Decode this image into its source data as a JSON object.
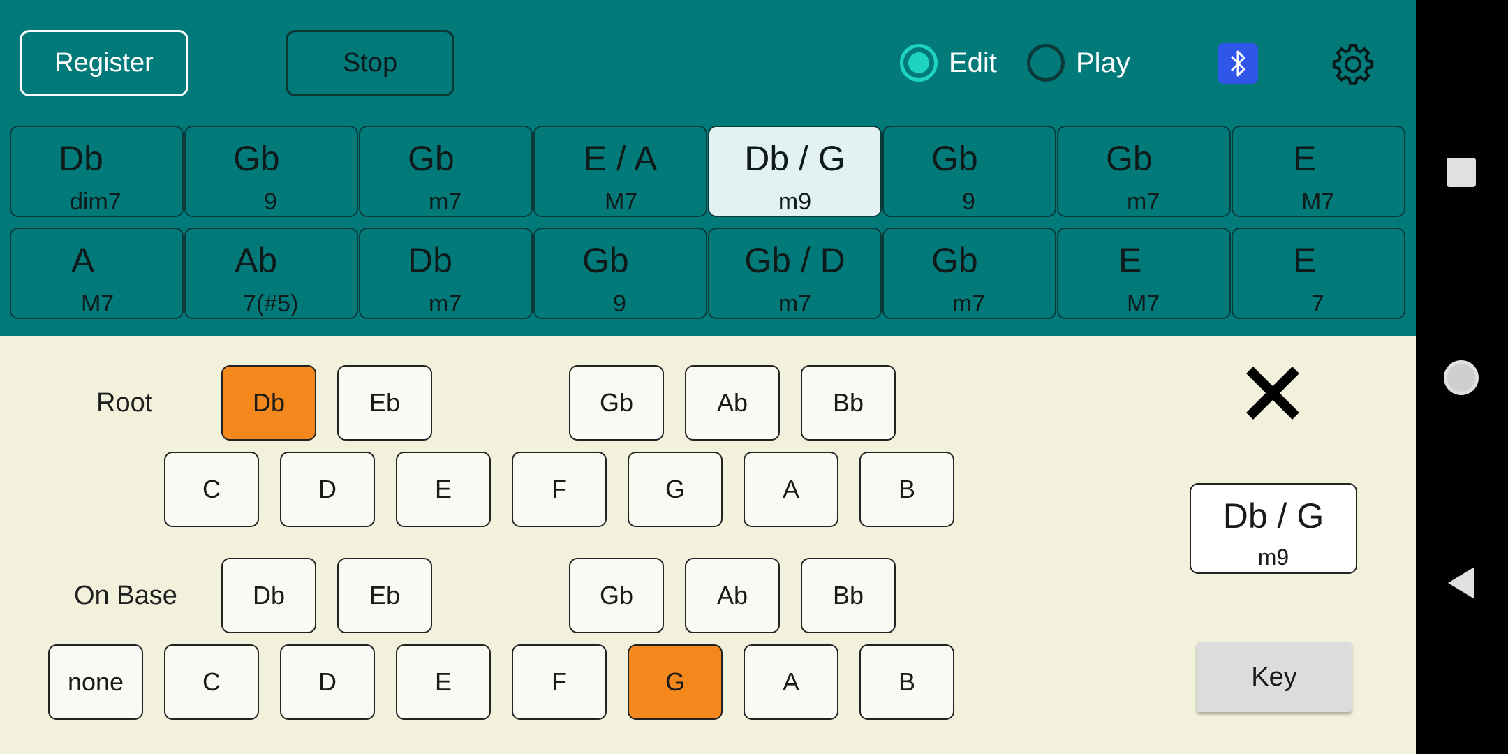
{
  "toolbar": {
    "register_label": "Register",
    "stop_label": "Stop",
    "mode_edit_label": "Edit",
    "mode_play_label": "Play",
    "selected_mode": "Edit",
    "bluetooth_icon": "bluetooth-icon",
    "settings_icon": "gear-icon",
    "bluetooth_color": "#2f55e9"
  },
  "progression": {
    "row1": [
      {
        "root": "Db",
        "quality": "dim7"
      },
      {
        "root": "Gb",
        "quality": "9"
      },
      {
        "root": "Gb",
        "quality": "m7"
      },
      {
        "root": "E / A",
        "quality": "M7"
      },
      {
        "root": "Db / G",
        "quality": "m9"
      },
      {
        "root": "Gb",
        "quality": "9"
      },
      {
        "root": "Gb",
        "quality": "m7"
      },
      {
        "root": "E",
        "quality": "M7"
      }
    ],
    "row2": [
      {
        "root": "A",
        "quality": "M7"
      },
      {
        "root": "Ab",
        "quality": "7(#5)"
      },
      {
        "root": "Db",
        "quality": "m7"
      },
      {
        "root": "Gb",
        "quality": "9"
      },
      {
        "root": "Gb / D",
        "quality": "m7"
      },
      {
        "root": "Gb",
        "quality": "m7"
      },
      {
        "root": "E",
        "quality": "M7"
      },
      {
        "root": "E",
        "quality": "7"
      }
    ],
    "selected_cell": "row1-5"
  },
  "editor": {
    "root_label": "Root",
    "on_base_label": "On Base",
    "root_sharps": [
      "Db",
      "Eb",
      "Gb",
      "Ab",
      "Bb"
    ],
    "root_naturals": [
      "C",
      "D",
      "E",
      "F",
      "G",
      "A",
      "B"
    ],
    "base_sharps": [
      "Db",
      "Eb",
      "Gb",
      "Ab",
      "Bb"
    ],
    "base_none": "none",
    "base_naturals": [
      "C",
      "D",
      "E",
      "F",
      "G",
      "A",
      "B"
    ],
    "selected_root": "Db",
    "selected_base": "G",
    "close_icon": "close-icon",
    "current_chord": {
      "root": "Db / G",
      "quality": "m9"
    },
    "key_label": "Key"
  },
  "colors": {
    "topbar": "#037a7a",
    "panel": "#f2f2dc",
    "accent": "#f5881c",
    "selected_cell": "#e4f1f2",
    "radio": "#1ed3c1"
  },
  "navbar": {
    "recents_icon": "square-icon",
    "home_icon": "circle-icon",
    "back_icon": "triangle-back-icon"
  }
}
